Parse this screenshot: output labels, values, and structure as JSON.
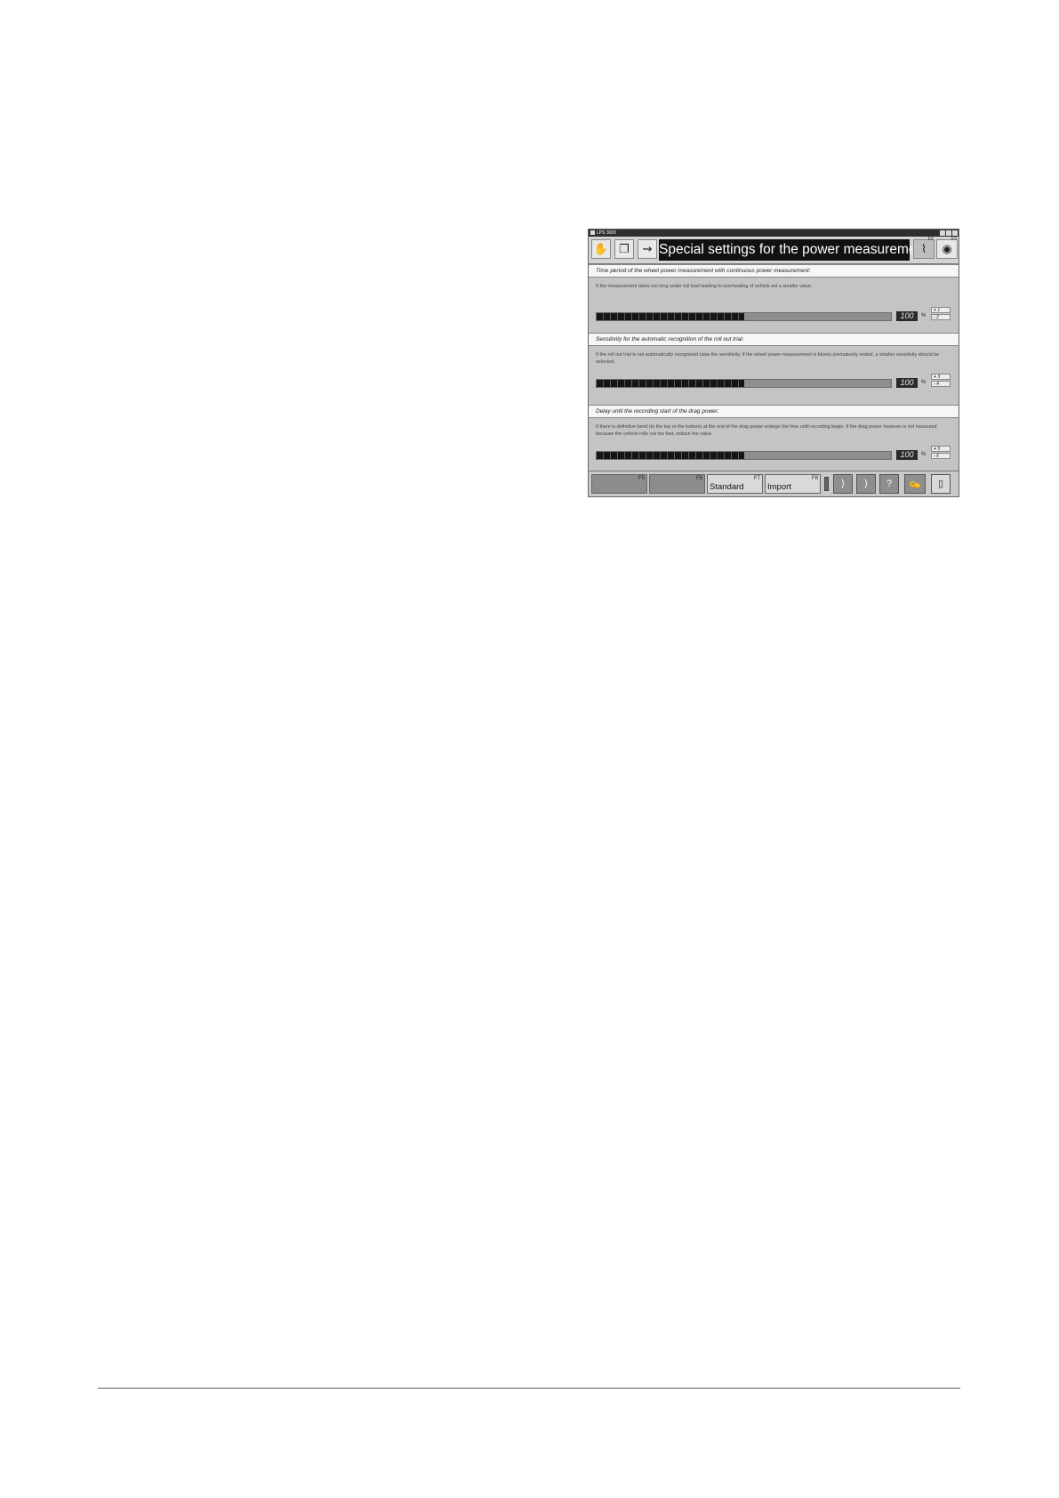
{
  "window": {
    "app_title": "LPS 3000",
    "title": "Special settings for the power measurement",
    "f2_key": "F2",
    "f3_key": "F3"
  },
  "sections": [
    {
      "header": "Time period of the wheel power measurement with continuous power measurement:",
      "description": "If the measurement takes too long under full load leading to overheating of vehicle set a smaller value.",
      "value": "100",
      "unit": "%",
      "fill_fraction": 0.5,
      "plus_key": "1",
      "minus_key": "2"
    },
    {
      "header": "Sensitivity for the automatic recognition of the roll out trial:",
      "description": "If the roll out trial is not automatically recognized raise the sensitivity. If the wheel power measurement is falsely prematurely ended, a smaller sensitivity should be selected.",
      "value": "100",
      "unit": "%",
      "fill_fraction": 0.5,
      "plus_key": "3",
      "minus_key": "4"
    },
    {
      "header": "Delay until the recording start of the drag power:",
      "description": "If there is definitive bend (to the top or the bottom) at the end of the drag power enlarge the time until recording begin. If the drag power however is not measured because the vehicle rolls out too fast, reduce the value.",
      "value": "100",
      "unit": "%",
      "fill_fraction": 0.5,
      "plus_key": "5",
      "minus_key": "6"
    }
  ],
  "bottom": {
    "f5_key": "F5",
    "f6_key": "F6",
    "standard_label": "Standard",
    "standard_key": "F7",
    "import_label": "Import",
    "import_key": "F8",
    "help_symbol": "?"
  },
  "stepper": {
    "plus": "+",
    "minus": "-"
  }
}
